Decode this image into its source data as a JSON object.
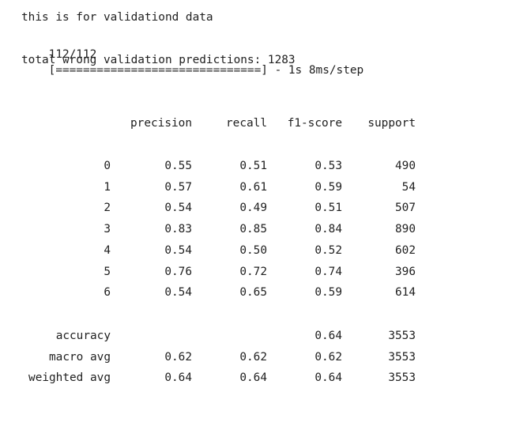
{
  "log": {
    "line1": "this is for validationd data",
    "progress_counter": "112/112",
    "progress_bar": "[==============================]",
    "progress_suffix": " - 1s 8ms/step",
    "wrong_label": "total wrong validation predictions: 1283"
  },
  "report": {
    "headers": [
      "precision",
      "recall",
      "f1-score",
      "support"
    ],
    "rows": [
      {
        "label": "0",
        "precision": "0.55",
        "recall": "0.51",
        "f1": "0.53",
        "support": "490"
      },
      {
        "label": "1",
        "precision": "0.57",
        "recall": "0.61",
        "f1": "0.59",
        "support": "54"
      },
      {
        "label": "2",
        "precision": "0.54",
        "recall": "0.49",
        "f1": "0.51",
        "support": "507"
      },
      {
        "label": "3",
        "precision": "0.83",
        "recall": "0.85",
        "f1": "0.84",
        "support": "890"
      },
      {
        "label": "4",
        "precision": "0.54",
        "recall": "0.50",
        "f1": "0.52",
        "support": "602"
      },
      {
        "label": "5",
        "precision": "0.76",
        "recall": "0.72",
        "f1": "0.74",
        "support": "396"
      },
      {
        "label": "6",
        "precision": "0.54",
        "recall": "0.65",
        "f1": "0.59",
        "support": "614"
      }
    ],
    "summary": [
      {
        "label": "accuracy",
        "precision": "",
        "recall": "",
        "f1": "0.64",
        "support": "3553"
      },
      {
        "label": "macro avg",
        "precision": "0.62",
        "recall": "0.62",
        "f1": "0.62",
        "support": "3553"
      },
      {
        "label": "weighted avg",
        "precision": "0.64",
        "recall": "0.64",
        "f1": "0.64",
        "support": "3553"
      }
    ]
  }
}
